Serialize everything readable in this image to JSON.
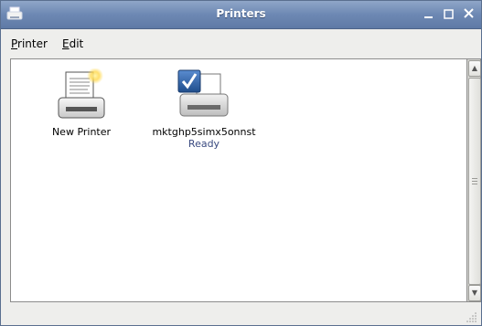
{
  "window": {
    "title": "Printers"
  },
  "menubar": {
    "items": [
      {
        "label": "Printer",
        "mnemonic": "P",
        "rest": "rinter"
      },
      {
        "label": "Edit",
        "mnemonic": "E",
        "rest": "dit"
      }
    ]
  },
  "printers": [
    {
      "name": "New Printer",
      "status": "",
      "icon": "new-printer-icon"
    },
    {
      "name": "mktghp5simx5onnst",
      "status": "Ready",
      "icon": "default-printer-icon"
    }
  ],
  "colors": {
    "titlebar": "#6d88b3",
    "status_text": "#3a4a80",
    "default_check": "#2d5fa0"
  }
}
